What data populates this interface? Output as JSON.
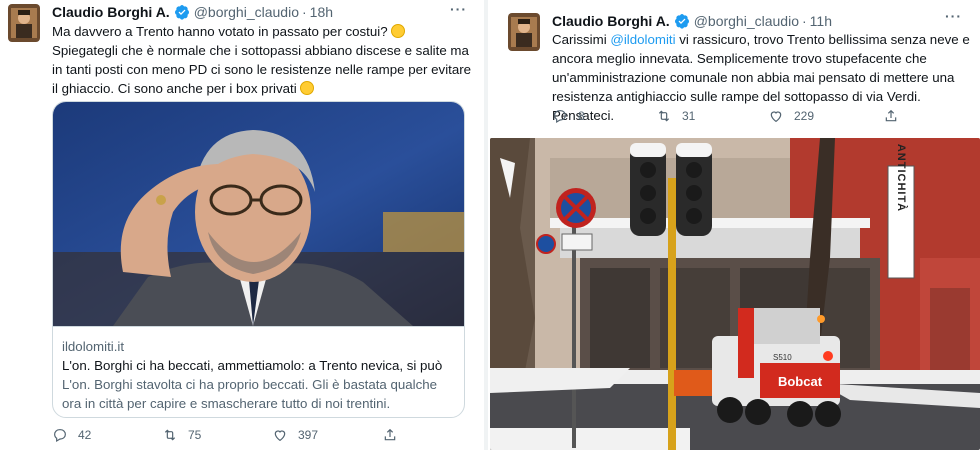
{
  "left_tweet": {
    "author_name": "Claudio Borghi A.",
    "handle": "@borghi_claudio",
    "separator": "·",
    "time": "18h",
    "more": "···",
    "text_line1": "Ma davvero a Trento hanno votato in passato per costui?",
    "text_line2": "Spiegategli che è normale che i sottopassi abbiano discese e salite ma in tanti posti con meno PD ci sono le resistenze nelle rampe per evitare il ghiaccio. Ci sono anche per i box privati",
    "card": {
      "domain": "ildolomiti.it",
      "title": "L'on. Borghi ci ha beccati, ammettiamolo: a Trento nevica, si può",
      "description": "L'on. Borghi stavolta ci ha proprio beccati. Gli è bastata qualche ora in città per capire e smascherare tutto di noi trentini. Ammettiamolo. ..."
    },
    "actions": {
      "replies": "42",
      "retweets": "75",
      "likes": "397"
    }
  },
  "right_tweet": {
    "author_name": "Claudio Borghi A.",
    "handle": "@borghi_claudio",
    "separator": "·",
    "time": "11h",
    "more": "···",
    "text_before_mention": "Carissimi ",
    "mention": "@ildolomiti",
    "text_after_mention": " vi rassicuro, trovo Trento bellissima senza neve e ancora meglio innevata. Semplicemente trovo stupefacente che un'amministrazione comunale non abbia mai pensato di mettere una resistenza antighiaccio sulle rampe del sottopasso di via Verdi. Pensateci.",
    "actions": {
      "replies": "8",
      "retweets": "31",
      "likes": "229"
    },
    "photo": {
      "shop_sign": "ANTICHITÀ",
      "vehicle_brand": "Bobcat",
      "vehicle_number": "S510"
    }
  },
  "colors": {
    "verified": "#1d9bf0",
    "mention": "#1d9bf0",
    "muted": "#536471",
    "text": "#0f1419",
    "border": "#cfd9de"
  },
  "icons": [
    "verified-badge-icon",
    "more-icon",
    "reply-icon",
    "retweet-icon",
    "like-icon",
    "share-icon"
  ]
}
